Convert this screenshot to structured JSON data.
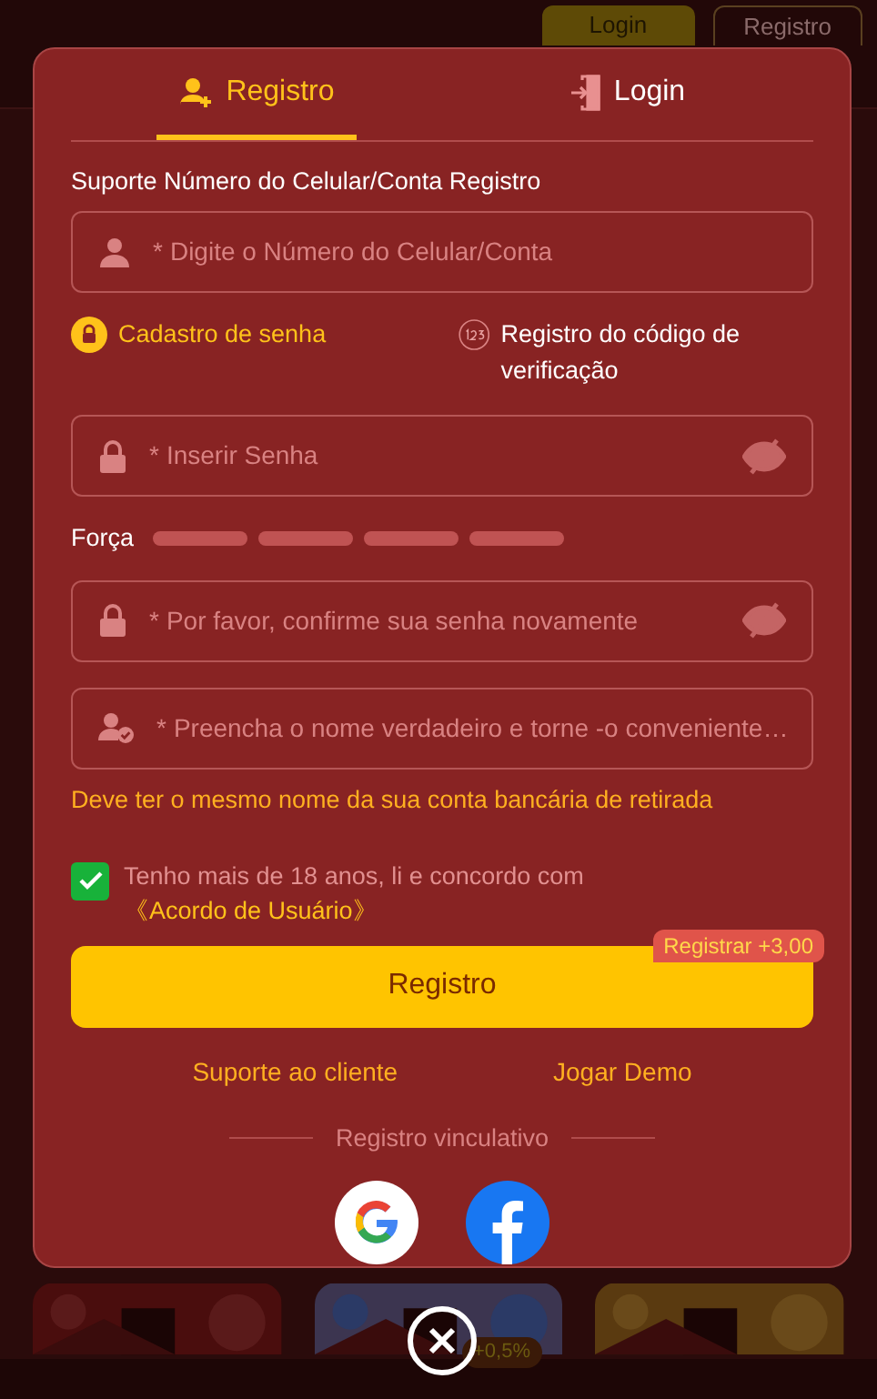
{
  "header": {
    "buttons": [
      {
        "label": "Login",
        "kind": "primary"
      },
      {
        "label": "Registro",
        "kind": "outline"
      }
    ]
  },
  "bottom_nav": {
    "badge": "+0,5%"
  },
  "modal": {
    "tabs": [
      {
        "label": "Registro",
        "kind": "register",
        "selected": true
      },
      {
        "label": "Login",
        "kind": "login",
        "selected": false
      }
    ],
    "account_label": "Suporte Número do Celular/Conta Registro",
    "account_field": {
      "placeholder": "Digite o Número do Celular/Conta",
      "marker": "*",
      "kind": "user"
    },
    "methods": [
      {
        "label": "Cadastro de senha",
        "kind": "password",
        "selected": true
      },
      {
        "label": "Registro do código de verificação",
        "kind": "code",
        "selected": false
      }
    ],
    "password_field": {
      "placeholder": "Inserir Senha",
      "marker": "*",
      "kind": "lock",
      "reveal_toggle": true
    },
    "strength": {
      "label": "Força",
      "segments": [
        {
          "active": false
        },
        {
          "active": false
        },
        {
          "active": false
        },
        {
          "active": false
        }
      ]
    },
    "confirm_field": {
      "placeholder": "Por favor, confirme sua senha novamente",
      "marker": "*",
      "kind": "lock",
      "reveal_toggle": true
    },
    "name_field": {
      "placeholder": "Preencha o nome verdadeiro e torne -o conveniente…",
      "marker": "*",
      "kind": "verified-user"
    },
    "name_hint": "Deve ter o mesmo nome da sua conta bancária de retirada",
    "agreement": {
      "text": "Tenho mais de 18 anos, li e concordo com",
      "link": "《Acordo de Usuário》",
      "checked": true
    },
    "submit": {
      "label": "Registro",
      "badge": "Registrar +3,00"
    },
    "links": [
      "Suporte ao cliente",
      "Jogar Demo"
    ],
    "social_label": "Registro vinculativo",
    "social": [
      {
        "kind": "google"
      },
      {
        "kind": "facebook"
      }
    ]
  }
}
